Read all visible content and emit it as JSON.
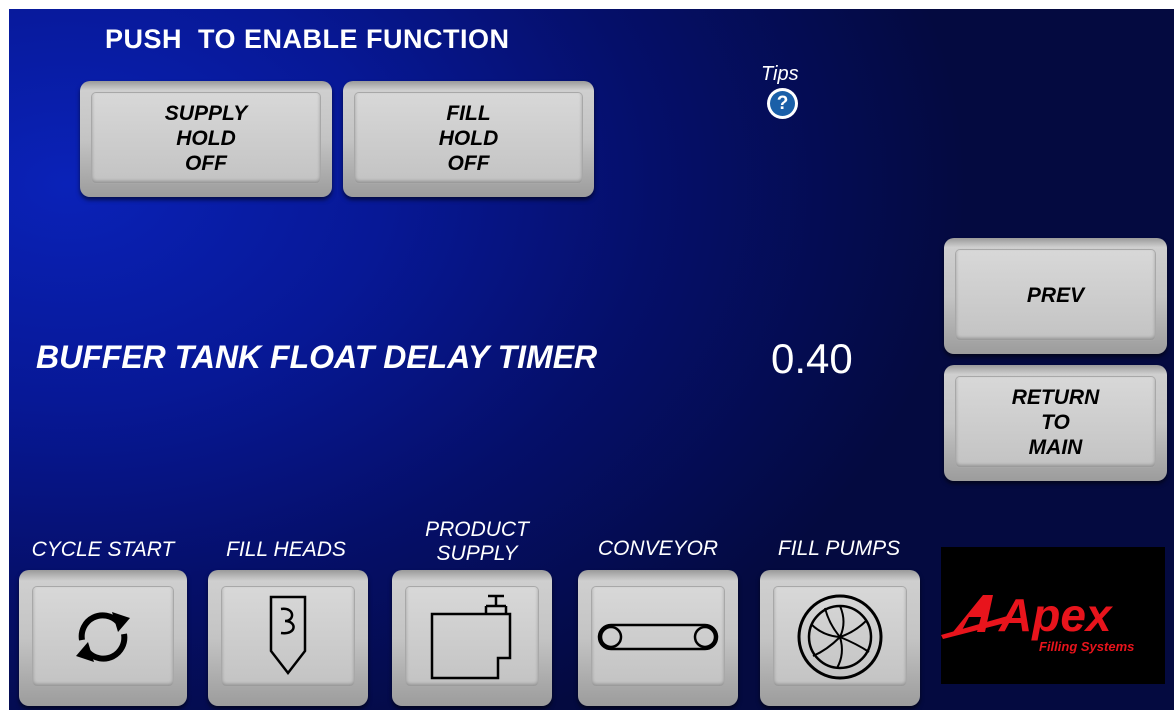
{
  "header": {
    "title": "PUSH  TO ENABLE FUNCTION"
  },
  "function_buttons": [
    {
      "lines": [
        "SUPPLY",
        "HOLD",
        "OFF"
      ]
    },
    {
      "lines": [
        "FILL",
        "HOLD",
        "OFF"
      ]
    }
  ],
  "tips": {
    "label": "Tips",
    "icon": "help-icon",
    "glyph": "?"
  },
  "parameter": {
    "label": "BUFFER TANK FLOAT DELAY TIMER",
    "value": "0.40"
  },
  "side_buttons": {
    "prev": "PREV",
    "return_lines": [
      "RETURN",
      "TO",
      "MAIN"
    ]
  },
  "nav": [
    {
      "label": "CYCLE START",
      "icon": "cycle-arrows-icon"
    },
    {
      "label": "FILL HEADS",
      "icon": "fill-head-icon"
    },
    {
      "label_lines": [
        "PRODUCT",
        "SUPPLY"
      ],
      "icon": "tank-icon"
    },
    {
      "label": "CONVEYOR",
      "icon": "conveyor-icon"
    },
    {
      "label": "FILL PUMPS",
      "icon": "pump-impeller-icon"
    }
  ],
  "logo": {
    "brand": "Apex",
    "tagline": "Filling Systems",
    "colors": {
      "red": "#e8141c",
      "background": "#000000"
    }
  },
  "colors": {
    "screen_bg": "#071896",
    "button_face": "#c8c8c8",
    "text": "#ffffff"
  }
}
